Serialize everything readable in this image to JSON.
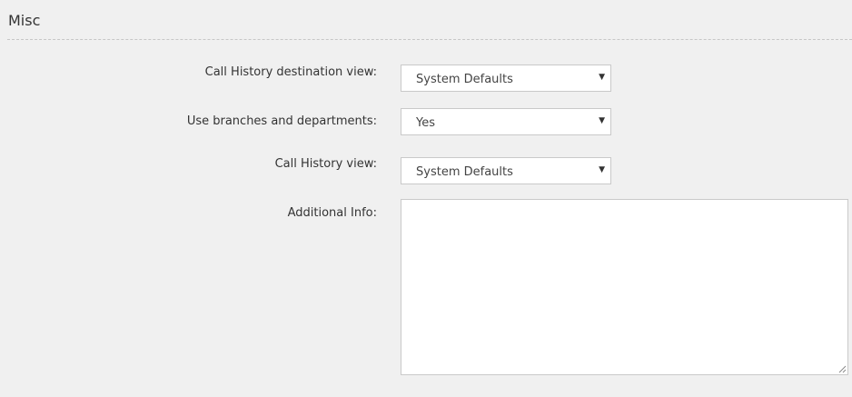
{
  "section": {
    "title": "Misc"
  },
  "fields": [
    {
      "label": "Call History destination view:",
      "value": "System Defaults"
    },
    {
      "label": "Use branches and departments:",
      "value": "Yes"
    },
    {
      "label": "Call History view:",
      "value": "System Defaults"
    },
    {
      "label": "Additional Info:",
      "value": ""
    }
  ],
  "icons": {
    "dropdown": "chevron-down-icon",
    "resize": "resize-grip-icon"
  },
  "colors": {
    "background": "#f0f0f0",
    "field_background": "#ffffff",
    "border": "#c9c9c9",
    "divider": "#c6c6c6"
  }
}
